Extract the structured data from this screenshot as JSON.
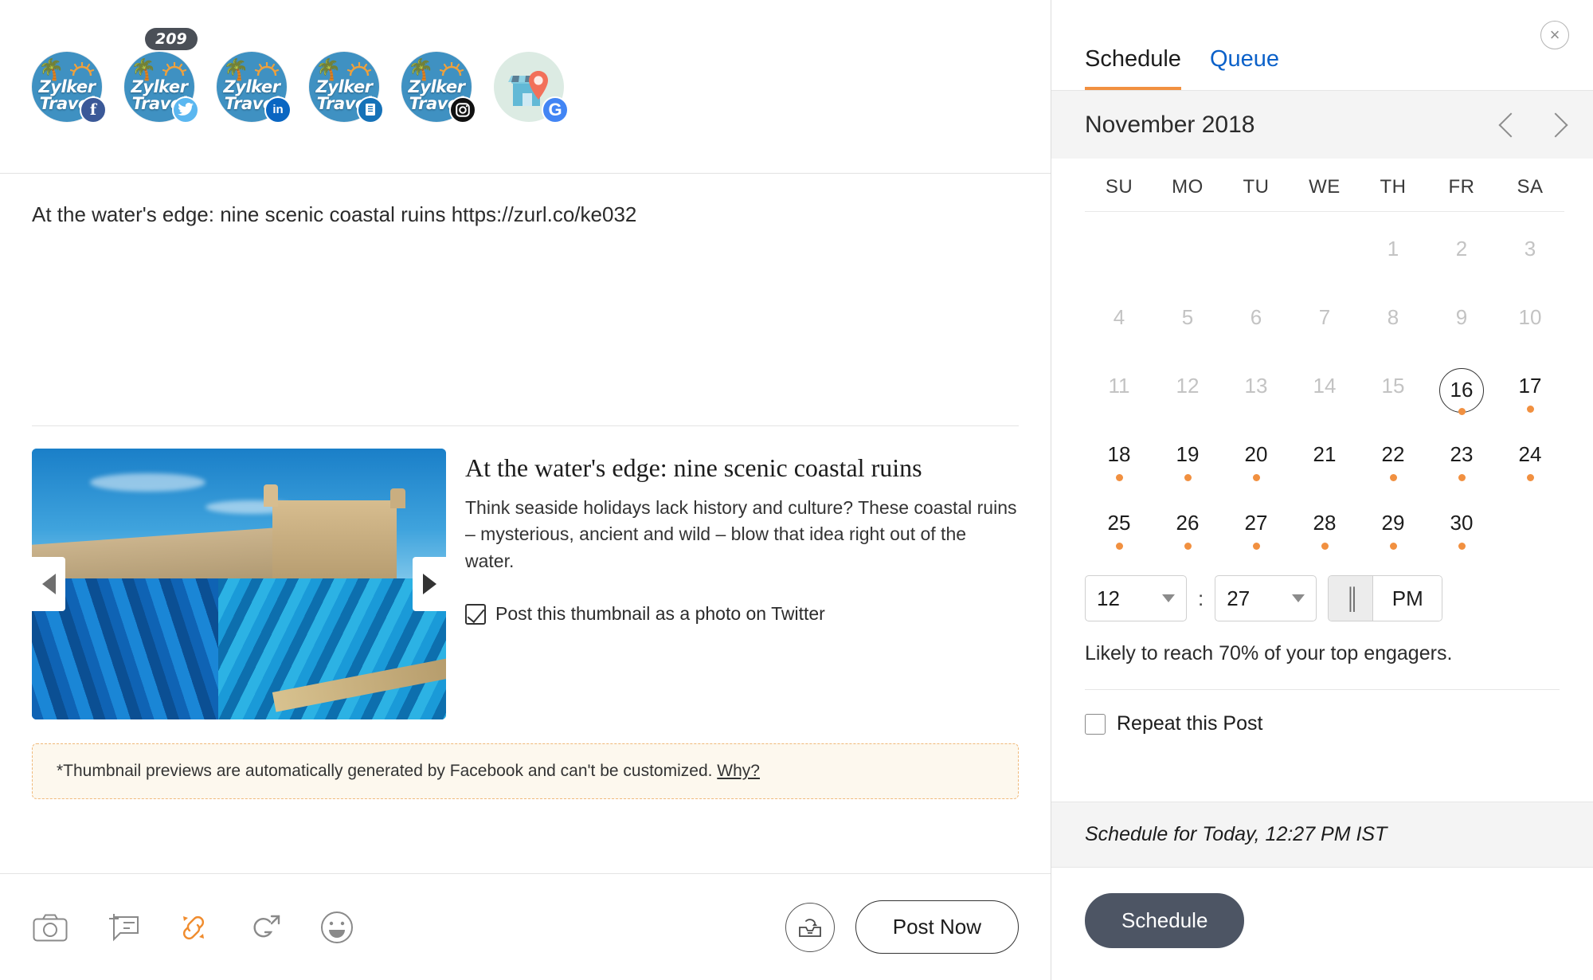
{
  "composer": {
    "accounts": [
      {
        "name": "Zylker Travel",
        "network": "facebook",
        "badge_glyph": "f",
        "counter": null
      },
      {
        "name": "Zylker Travel",
        "network": "twitter",
        "badge_glyph": "ᵗ",
        "counter": "209"
      },
      {
        "name": "Zylker Travel",
        "network": "linkedin",
        "badge_glyph": "in",
        "counter": null
      },
      {
        "name": "Zylker Travel",
        "network": "zoho-social",
        "badge_glyph": "▤",
        "counter": null
      },
      {
        "name": "Zylker Travel",
        "network": "instagram",
        "badge_glyph": "◎",
        "counter": null
      },
      {
        "name": "Google My Business",
        "network": "google-my-business",
        "badge_glyph": "G",
        "counter": null
      }
    ],
    "brand_line1": "Zylker",
    "brand_line2": "Travel",
    "post_text": "At the water's edge: nine scenic coastal ruins https://zurl.co/ke032",
    "link_preview": {
      "title": "At the water's edge: nine scenic coastal ruins",
      "description": "Think seaside holidays lack history and culture? These coastal ruins – mysterious, ancient and wild – blow that idea right out of the water.",
      "thumbnail_alt": "Coastal fortress with blue fishing boats",
      "checkbox_label": "Post this thumbnail as a photo on Twitter",
      "checkbox_checked": true
    },
    "notice": {
      "text": "*Thumbnail previews are automatically generated by Facebook and can't be customized. ",
      "link_text": "Why?"
    },
    "toolbar": {
      "icons": [
        {
          "name": "camera-icon",
          "label": "Add image"
        },
        {
          "name": "add-comment-icon",
          "label": "Add first comment"
        },
        {
          "name": "link-icon",
          "label": "Shorten link",
          "active": true
        },
        {
          "name": "grammar-icon",
          "label": "Grammar check"
        },
        {
          "name": "emoji-icon",
          "label": "Add emoji"
        }
      ],
      "draft_label": "Save as draft",
      "post_now_label": "Post Now"
    }
  },
  "schedule": {
    "close_label": "×",
    "tabs": [
      {
        "label": "Schedule",
        "active": true
      },
      {
        "label": "Queue",
        "active": false
      }
    ],
    "month_label": "November 2018",
    "prev_label": "Previous month",
    "next_label": "Next month",
    "weekdays": [
      "SU",
      "MO",
      "TU",
      "WE",
      "TH",
      "FR",
      "SA"
    ],
    "weeks": [
      [
        {
          "day": "",
          "state": "empty",
          "dot": false
        },
        {
          "day": "",
          "state": "empty",
          "dot": false
        },
        {
          "day": "",
          "state": "empty",
          "dot": false
        },
        {
          "day": "",
          "state": "empty",
          "dot": false
        },
        {
          "day": "1",
          "state": "dim",
          "dot": false
        },
        {
          "day": "2",
          "state": "dim",
          "dot": false
        },
        {
          "day": "3",
          "state": "dim",
          "dot": false
        }
      ],
      [
        {
          "day": "4",
          "state": "dim",
          "dot": false
        },
        {
          "day": "5",
          "state": "dim",
          "dot": false
        },
        {
          "day": "6",
          "state": "dim",
          "dot": false
        },
        {
          "day": "7",
          "state": "dim",
          "dot": false
        },
        {
          "day": "8",
          "state": "dim",
          "dot": false
        },
        {
          "day": "9",
          "state": "dim",
          "dot": false
        },
        {
          "day": "10",
          "state": "dim",
          "dot": false
        }
      ],
      [
        {
          "day": "11",
          "state": "dim",
          "dot": false
        },
        {
          "day": "12",
          "state": "dim",
          "dot": false
        },
        {
          "day": "13",
          "state": "dim",
          "dot": false
        },
        {
          "day": "14",
          "state": "dim",
          "dot": false
        },
        {
          "day": "15",
          "state": "dim",
          "dot": false
        },
        {
          "day": "16",
          "state": "selected",
          "dot": true
        },
        {
          "day": "17",
          "state": "normal",
          "dot": true
        }
      ],
      [
        {
          "day": "18",
          "state": "normal",
          "dot": true
        },
        {
          "day": "19",
          "state": "normal",
          "dot": true
        },
        {
          "day": "20",
          "state": "normal",
          "dot": true
        },
        {
          "day": "21",
          "state": "normal",
          "dot": false
        },
        {
          "day": "22",
          "state": "normal",
          "dot": true
        },
        {
          "day": "23",
          "state": "normal",
          "dot": true
        },
        {
          "day": "24",
          "state": "normal",
          "dot": true
        }
      ],
      [
        {
          "day": "25",
          "state": "normal",
          "dot": true
        },
        {
          "day": "26",
          "state": "normal",
          "dot": true
        },
        {
          "day": "27",
          "state": "normal",
          "dot": true
        },
        {
          "day": "28",
          "state": "normal",
          "dot": true
        },
        {
          "day": "29",
          "state": "normal",
          "dot": true
        },
        {
          "day": "30",
          "state": "normal",
          "dot": true
        },
        {
          "day": "",
          "state": "empty",
          "dot": false
        }
      ]
    ],
    "time": {
      "hour": "12",
      "separator": ":",
      "minute": "27",
      "meridiem_inactive": "║",
      "meridiem": "PM"
    },
    "reach_text": "Likely to reach 70% of your top engagers.",
    "repeat_label": "Repeat this Post",
    "repeat_checked": false,
    "summary": "Schedule for Today, 12:27 PM  IST",
    "schedule_button": "Schedule"
  },
  "colors": {
    "accent_orange": "#f19040",
    "link_blue": "#0b61c9",
    "schedule_btn": "#4d5564",
    "brand_blue": "#3f91c2"
  }
}
